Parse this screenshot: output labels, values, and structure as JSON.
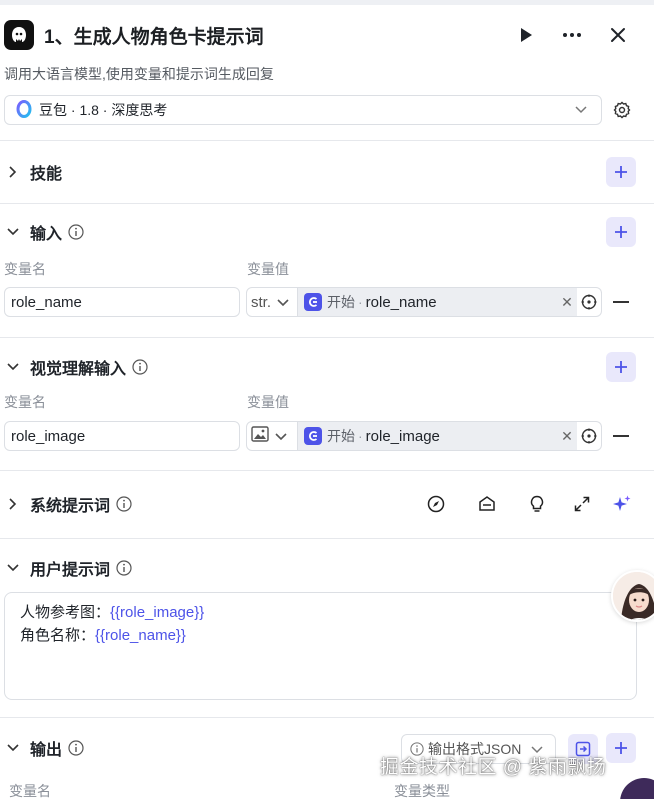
{
  "node": {
    "title": "1、生成人物角色卡提示词",
    "description": "调用大语言模型,使用变量和提示词生成回复",
    "icon": "llm-node-icon"
  },
  "header_actions": [
    "play-icon",
    "more-icon",
    "close-icon"
  ],
  "model": {
    "label": "豆包 · 1.8 · 深度思考",
    "icon": "doubao-logo-icon"
  },
  "sections": {
    "skills": {
      "title": "技能"
    },
    "input": {
      "title": "输入",
      "col_name": "变量名",
      "col_value": "变量值",
      "rows": [
        {
          "name": "role_name",
          "type": "str.",
          "source": "开始",
          "var": "role_name"
        }
      ]
    },
    "vision_input": {
      "title": "视觉理解输入",
      "col_name": "变量名",
      "col_value": "变量值",
      "rows": [
        {
          "name": "role_image",
          "type_icon": "image-icon",
          "source": "开始",
          "var": "role_image"
        }
      ]
    },
    "system_prompt": {
      "title": "系统提示词",
      "tools": [
        "compass-icon",
        "library-icon",
        "bulb-icon",
        "expand-icon",
        "sparkle-icon"
      ]
    },
    "user_prompt": {
      "title": "用户提示词",
      "lines": [
        {
          "label": "人物参考图：",
          "var": "{{role_image}}"
        },
        {
          "label": "角色名称：",
          "var": "{{role_name}}"
        }
      ]
    },
    "output": {
      "title": "输出",
      "format_label": "输出格式JSON",
      "col_name": "变量名",
      "col_type": "变量类型"
    }
  },
  "watermark": "掘金技术社区 @ 紫雨飘扬",
  "colors": {
    "accent": "#4d53e8",
    "accent_bg": "#e9e8fb",
    "border": "#dcdfe4"
  }
}
